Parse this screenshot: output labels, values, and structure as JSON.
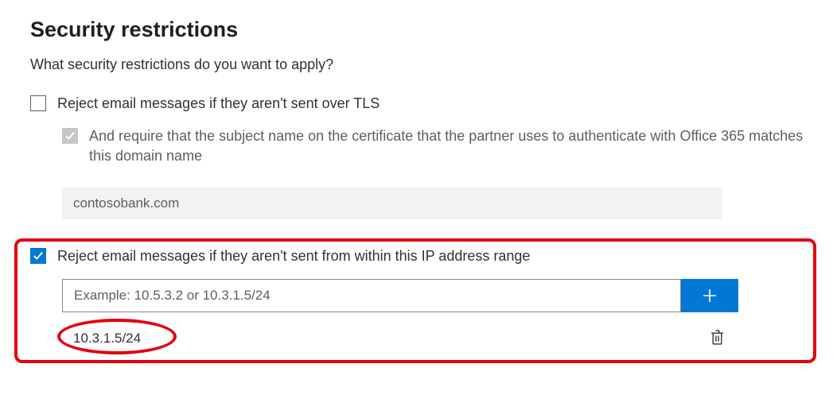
{
  "title": "Security restrictions",
  "intro": "What security restrictions do you want to apply?",
  "tls_option": {
    "label": "Reject email messages if they aren't sent over TLS",
    "checked": false,
    "nested": {
      "label": "And require that the subject name on the certificate that the partner uses to authenticate with Office 365 matches this domain name",
      "checked": false,
      "domain_value": "contosobank.com"
    }
  },
  "ip_option": {
    "label": "Reject email messages if they aren't sent from within this IP address range",
    "checked": true,
    "input_placeholder": "Example: 10.5.3.2 or 10.3.1.5/24",
    "input_value": "",
    "entries": [
      {
        "value": "10.3.1.5/24"
      }
    ]
  }
}
